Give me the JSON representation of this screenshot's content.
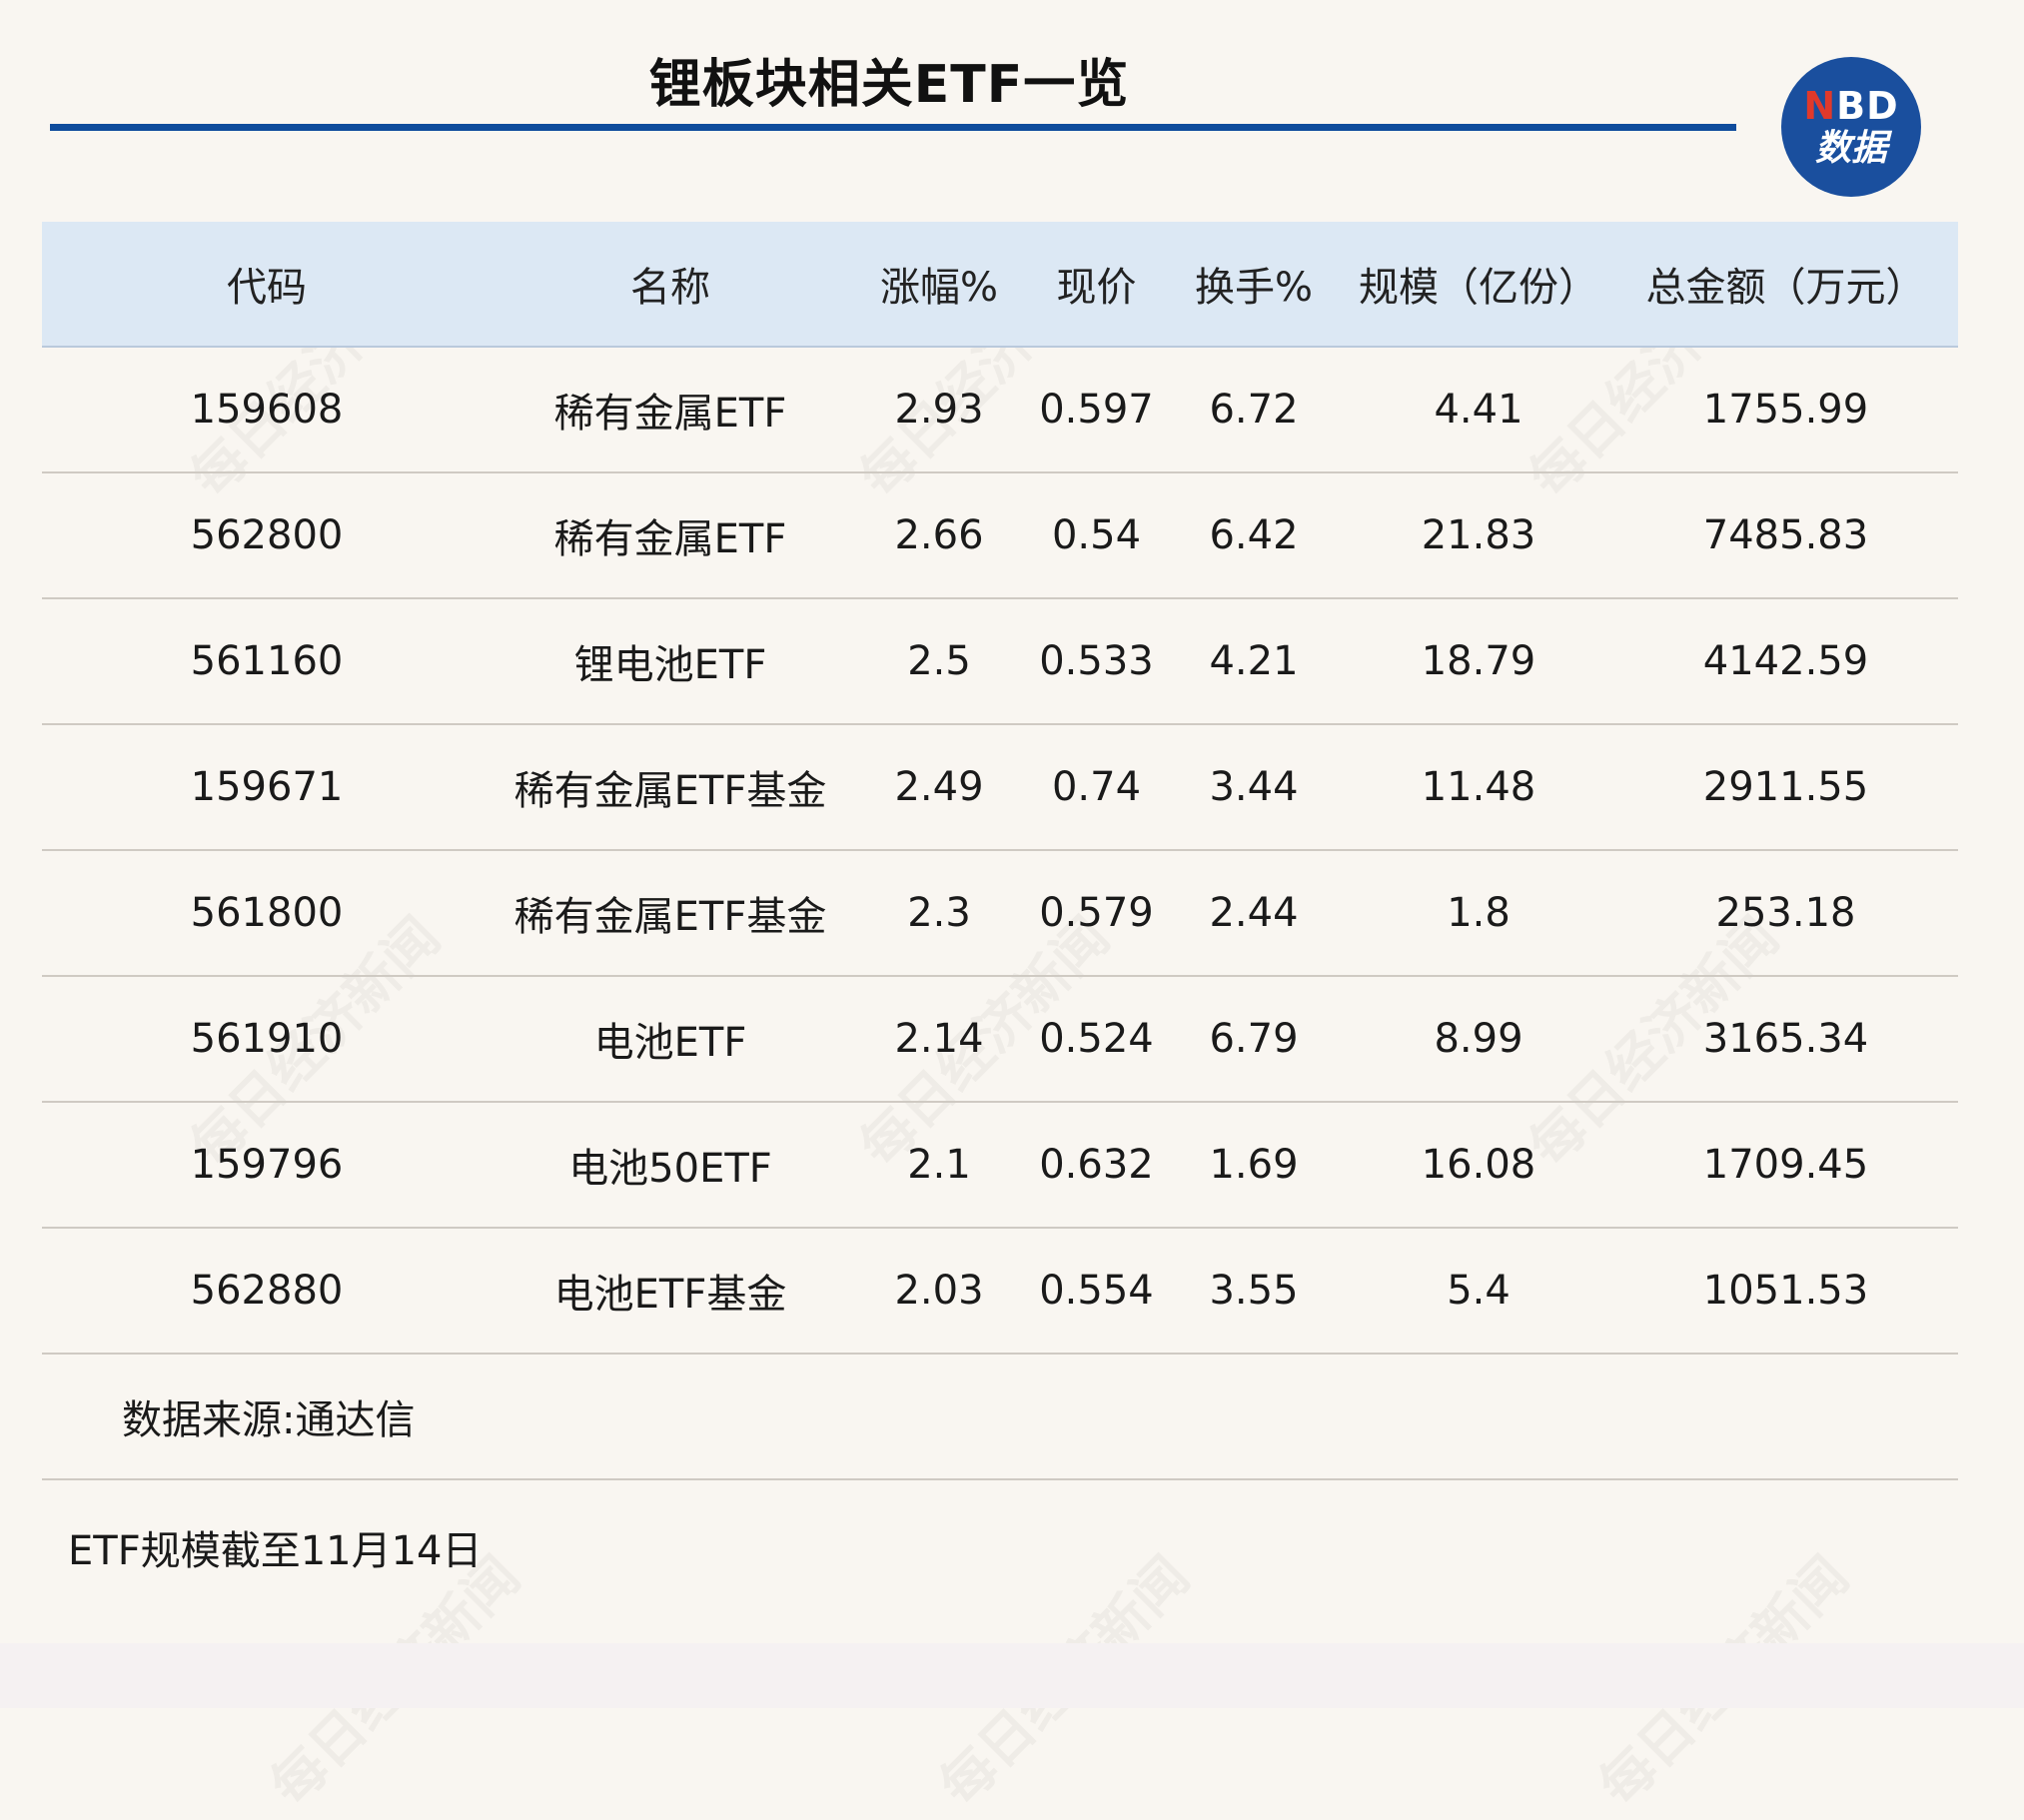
{
  "title": "锂板块相关ETF一览",
  "logo": {
    "line1_n": "N",
    "line1_rest": "BD",
    "line2": "数据"
  },
  "watermark": "每日经济新闻",
  "table": {
    "headers": [
      "代码",
      "名称",
      "涨幅%",
      "现价",
      "换手%",
      "规模（亿份）",
      "总金额（万元）"
    ],
    "rows": [
      [
        "159608",
        "稀有金属ETF",
        "2.93",
        "0.597",
        "6.72",
        "4.41",
        "1755.99"
      ],
      [
        "562800",
        "稀有金属ETF",
        "2.66",
        "0.54",
        "6.42",
        "21.83",
        "7485.83"
      ],
      [
        "561160",
        "锂电池ETF",
        "2.5",
        "0.533",
        "4.21",
        "18.79",
        "4142.59"
      ],
      [
        "159671",
        "稀有金属ETF基金",
        "2.49",
        "0.74",
        "3.44",
        "11.48",
        "2911.55"
      ],
      [
        "561800",
        "稀有金属ETF基金",
        "2.3",
        "0.579",
        "2.44",
        "1.8",
        "253.18"
      ],
      [
        "561910",
        "电池ETF",
        "2.14",
        "0.524",
        "6.79",
        "8.99",
        "3165.34"
      ],
      [
        "159796",
        "电池50ETF",
        "2.1",
        "0.632",
        "1.69",
        "16.08",
        "1709.45"
      ],
      [
        "562880",
        "电池ETF基金",
        "2.03",
        "0.554",
        "3.55",
        "5.4",
        "1051.53"
      ]
    ]
  },
  "source_note": "数据来源:通达信",
  "scale_note": "ETF规模截至11月14日",
  "colors": {
    "accent": "#0f4c9c",
    "header_bg": "#dce8f4",
    "page_bg": "#f9f6f1",
    "logo_bg": "#1a4f9e",
    "logo_red": "#e0392b"
  }
}
